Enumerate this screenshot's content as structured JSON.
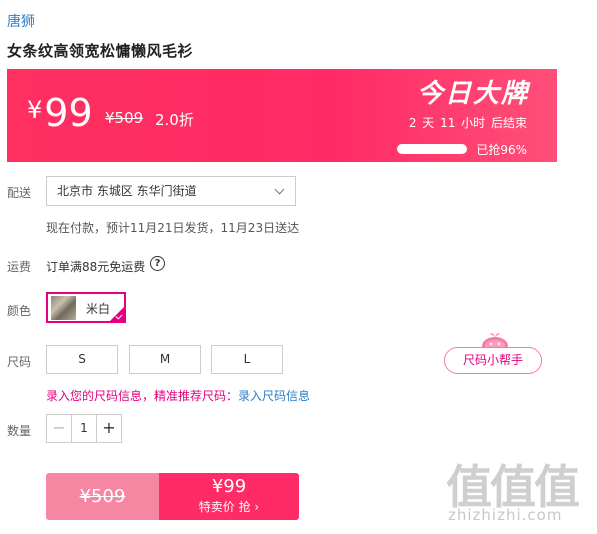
{
  "brand": "唐狮",
  "product_title": "女条纹高领宽松慵懒风毛衫",
  "promo": {
    "currency": "¥",
    "price": "99",
    "original_price": "¥509",
    "discount": "2.0折",
    "banner_title": "今日大牌",
    "countdown": "2 天 11 小时 后结束",
    "sold_percent": 0.96,
    "sold_text": "已抢96%"
  },
  "delivery": {
    "label": "配送",
    "address": "北京市 东城区 东华门街道",
    "schedule": "现在付款，预计11月21日发货，11月23日送达"
  },
  "freight": {
    "label": "运费",
    "text": "订单满88元免运费",
    "help_glyph": "?"
  },
  "color": {
    "label": "颜色",
    "selected": "米白"
  },
  "size": {
    "label": "尺码",
    "options": [
      "S",
      "M",
      "L"
    ],
    "helper_label": "尺码小帮手",
    "tip_prefix": "录入您的尺码信息，精准推荐尺码：",
    "tip_link": "录入尺码信息"
  },
  "quantity": {
    "label": "数量",
    "minus": "−",
    "value": "1",
    "plus": "+"
  },
  "buy": {
    "original_price": "¥509",
    "price": "¥99",
    "action_label": "特卖价 抢 ›"
  },
  "watermark": {
    "logo": "值值值",
    "text": "zhizhizhi.com"
  },
  "colors": {
    "accent": "#ff2b66",
    "magenta": "#e4007f",
    "link": "#2d7ec6",
    "buy_left": "#f587a3"
  }
}
